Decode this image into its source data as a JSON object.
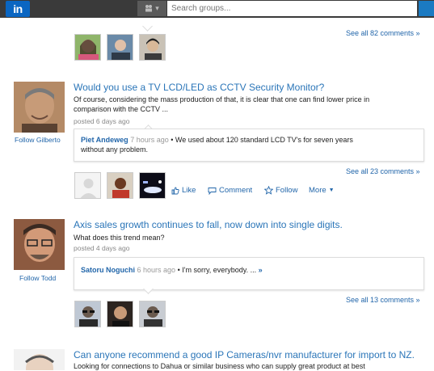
{
  "topbar": {
    "logo": "in",
    "search_placeholder": "Search groups..."
  },
  "top_section": {
    "see_all": "See all 82 comments »"
  },
  "posts": [
    {
      "title": "Would you use a TV LCD/LED as CCTV Security Monitor?",
      "body_line1": "Of course, considering the mass production of that, it is clear that one can find lower price in",
      "body_line2": "comparison with the CCTV ...",
      "posted": "posted 6 days ago",
      "follow": "Follow Gilberto",
      "comment": {
        "author": "Piet Andeweg",
        "time": "7 hours ago",
        "text1": "• We used about 120 standard LCD TV's for seven years",
        "text2": "without any problem."
      },
      "see_all": "See all 23 comments »",
      "actions": {
        "like": "Like",
        "comment": "Comment",
        "follow": "Follow",
        "more": "More"
      }
    },
    {
      "title": "Axis sales growth continues to fall, now down into single digits.",
      "body_line1": "What does this trend mean?",
      "posted": "posted 4 days ago",
      "follow": "Follow Todd",
      "comment": {
        "author": "Satoru Noguchi",
        "time": "6 hours ago",
        "text1": "• I'm sorry, everybody. ...",
        "more": "»"
      },
      "see_all": "See all 13 comments »"
    },
    {
      "title": "Can anyone recommend a good IP Cameras/nvr manufacturer for import to NZ.",
      "body_line1": "Looking for connections to Dahua or similar business who can supply great product at best"
    }
  ]
}
